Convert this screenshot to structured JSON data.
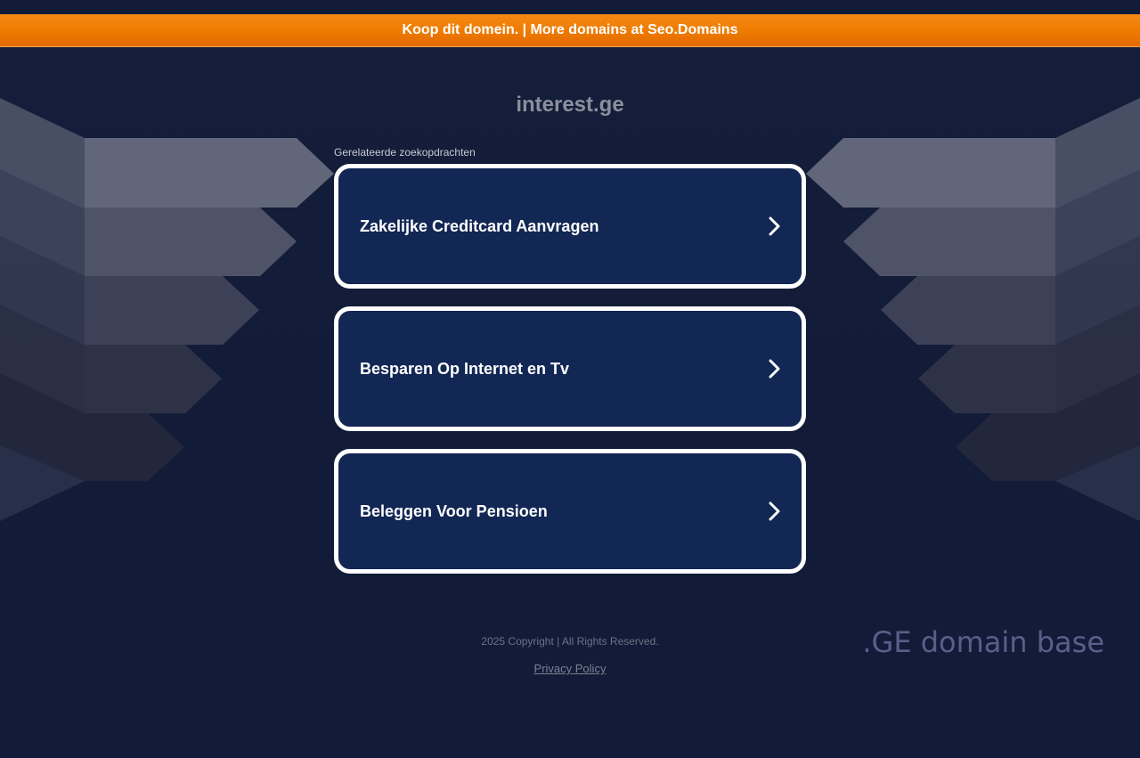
{
  "banner": {
    "text": "Koop dit domein. | More domains at Seo.Domains"
  },
  "page": {
    "domain": "interest.ge",
    "related_label": "Gerelateerde zoekopdrachten"
  },
  "results": [
    {
      "label": "Zakelijke Creditcard Aanvragen"
    },
    {
      "label": "Besparen Op Internet en Tv"
    },
    {
      "label": "Beleggen Voor Pensioen"
    }
  ],
  "footer": {
    "copyright": "2025 Copyright | All Rights Reserved.",
    "privacy": "Privacy Policy"
  },
  "brand": {
    "text": ".GE domain base"
  },
  "colors": {
    "background": "#131d3a",
    "banner": "#ee7a00",
    "card": "#122754",
    "card_border": "#ffffff"
  },
  "icons": {
    "result_arrow": "chevron-right-icon"
  }
}
